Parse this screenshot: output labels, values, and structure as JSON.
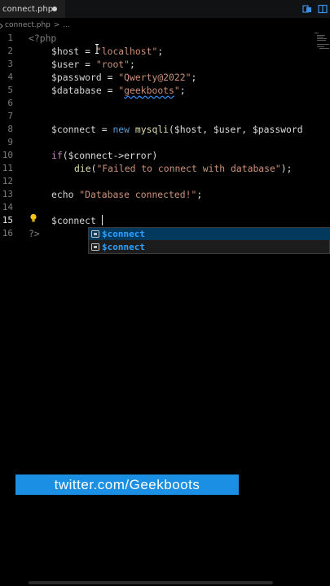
{
  "editor": {
    "tab_label": "connect.php",
    "breadcrumb_file": "connect.php",
    "breadcrumb_sep": ">",
    "breadcrumb_more": "...",
    "current_line": 15
  },
  "gutter": [
    "1",
    "2",
    "3",
    "4",
    "5",
    "6",
    "7",
    "8",
    "9",
    "10",
    "11",
    "12",
    "13",
    "14",
    "15",
    "16"
  ],
  "code": {
    "l1_open": "<?php",
    "l2_var": "$host",
    "l2_eq": " = ",
    "l2_str": "\"localhost\"",
    "l2_end": ";",
    "l3_var": "$user",
    "l3_eq": " = ",
    "l3_str": "\"root\"",
    "l3_end": ";",
    "l4_var": "$password",
    "l4_eq": " = ",
    "l4_str": "\"Qwerty@2022\"",
    "l4_end": ";",
    "l5_var": "$database",
    "l5_eq": " = ",
    "l5_q1": "\"",
    "l5_word": "geekboots",
    "l5_q2": "\"",
    "l5_end": ";",
    "l8_var": "$connect",
    "l8_eq": " = ",
    "l8_new": "new",
    "l8_cls": " mysqli",
    "l8_args": "($host, $user, $password",
    "l10_if": "if",
    "l10_cond": "($connect->error)",
    "l11_die": "die",
    "l11_p1": "(",
    "l11_str": "\"Failed to connect with database\"",
    "l11_p2": ");",
    "l13_echo": "echo",
    "l13_str": " \"Database connected!\"",
    "l13_end": ";",
    "l15_var": "$connect",
    "l16_close": "?>"
  },
  "suggestions": [
    {
      "label": "$connect",
      "icon": "variable-icon",
      "selected": true
    },
    {
      "label": "$connect",
      "icon": "variable-icon",
      "selected": false
    }
  ],
  "banner": {
    "text": "twitter.com/Geekboots"
  },
  "colors": {
    "background": "#000000",
    "keyword": "#569cd6",
    "string": "#ce9178",
    "function": "#dcdcaa",
    "suggest_selected": "#04395e",
    "suggest_text": "#2aa1ff",
    "banner": "#1a8fe3"
  }
}
